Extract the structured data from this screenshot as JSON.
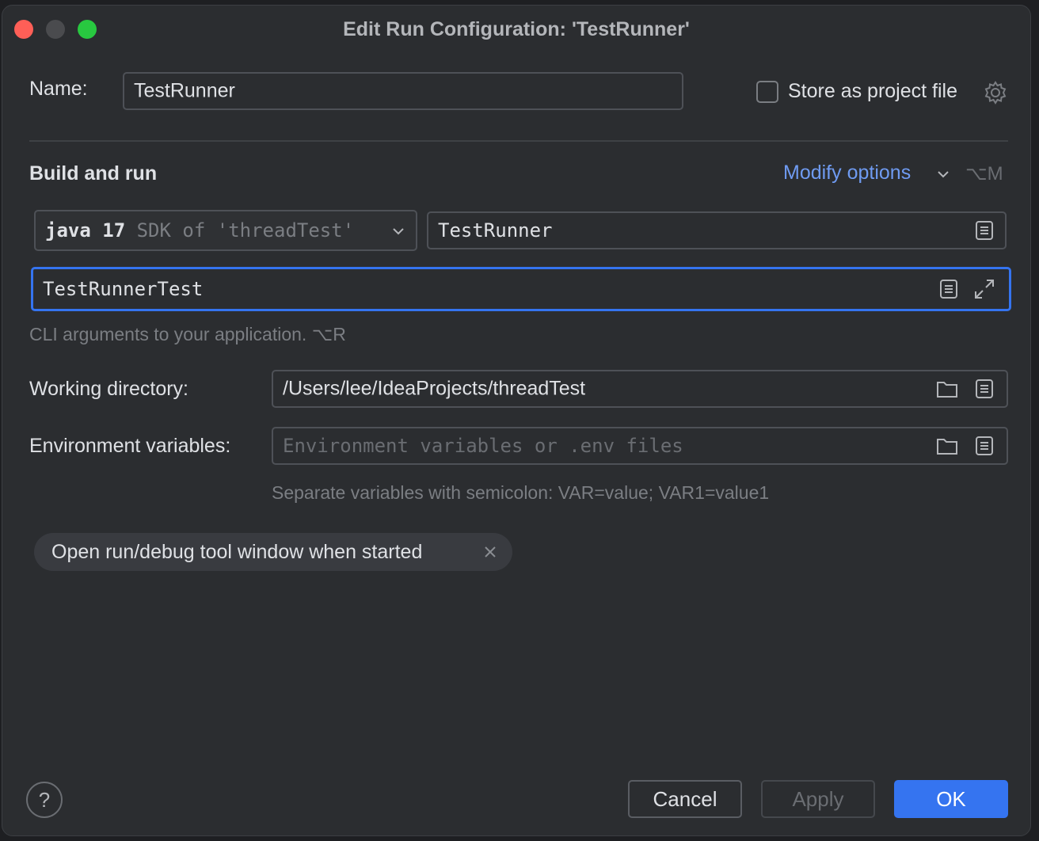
{
  "window": {
    "title": "Edit Run Configuration: 'TestRunner'"
  },
  "name_row": {
    "label": "Name:",
    "value": "TestRunner",
    "store_label": "Store as project file",
    "store_checked": false
  },
  "build_and_run": {
    "title": "Build and run",
    "modify_options": "Modify options",
    "modify_shortcut": "⌥M",
    "sdk_version": "java 17",
    "sdk_detail": "SDK of 'threadTest'",
    "main_class": "TestRunner",
    "program_args": "TestRunnerTest",
    "program_args_hint": "CLI arguments to your application. ⌥R"
  },
  "working_directory": {
    "label": "Working directory:",
    "value": "/Users/lee/IdeaProjects/threadTest"
  },
  "environment": {
    "label": "Environment variables:",
    "placeholder": "Environment variables or .env files",
    "hint": "Separate variables with semicolon: VAR=value; VAR1=value1"
  },
  "chip": {
    "label": "Open run/debug tool window when started"
  },
  "footer": {
    "help": "?",
    "cancel": "Cancel",
    "apply": "Apply",
    "ok": "OK"
  },
  "colors": {
    "accent": "#3574f0",
    "link": "#6f9bf2",
    "background": "#2b2d30"
  }
}
